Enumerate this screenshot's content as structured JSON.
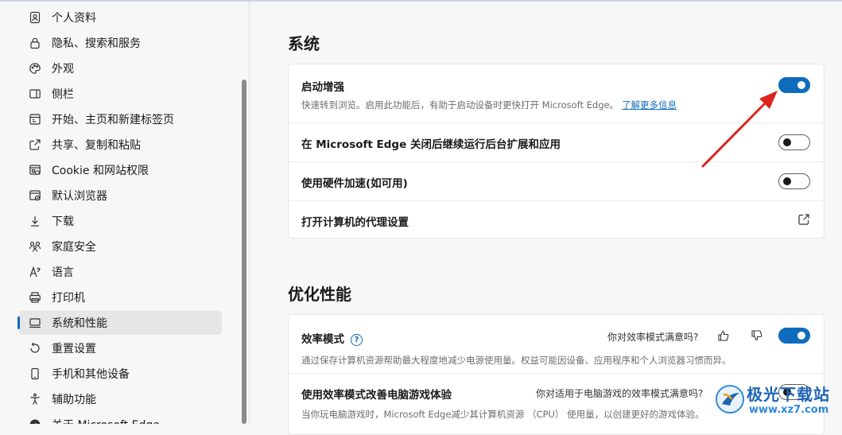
{
  "sidebar": {
    "items": [
      {
        "label": "个人资料",
        "icon": "profile-icon"
      },
      {
        "label": "隐私、搜索和服务",
        "icon": "lock-icon"
      },
      {
        "label": "外观",
        "icon": "palette-icon"
      },
      {
        "label": "侧栏",
        "icon": "sidebar-icon"
      },
      {
        "label": "开始、主页和新建标签页",
        "icon": "home-page-icon"
      },
      {
        "label": "共享、复制和粘贴",
        "icon": "share-icon"
      },
      {
        "label": "Cookie 和网站权限",
        "icon": "site-permissions-icon"
      },
      {
        "label": "默认浏览器",
        "icon": "default-browser-icon"
      },
      {
        "label": "下载",
        "icon": "download-icon"
      },
      {
        "label": "家庭安全",
        "icon": "family-icon"
      },
      {
        "label": "语言",
        "icon": "language-icon"
      },
      {
        "label": "打印机",
        "icon": "printer-icon"
      },
      {
        "label": "系统和性能",
        "icon": "system-icon",
        "active": true
      },
      {
        "label": "重置设置",
        "icon": "reset-icon"
      },
      {
        "label": "手机和其他设备",
        "icon": "phone-icon"
      },
      {
        "label": "辅助功能",
        "icon": "accessibility-icon"
      },
      {
        "label": "关于 Microsoft Edge",
        "icon": "edge-icon"
      }
    ]
  },
  "system": {
    "title": "系统",
    "startup_boost": {
      "title": "启动增强",
      "desc": "快速转到浏览。启用此功能后，有助于启动设备时更快打开 Microsoft Edge。",
      "link": "了解更多信息",
      "enabled": true
    },
    "background_run": {
      "title": "在 Microsoft Edge 关闭后继续运行后台扩展和应用",
      "enabled": false
    },
    "hardware_accel": {
      "title": "使用硬件加速(如可用)",
      "enabled": false
    },
    "proxy": {
      "title": "打开计算机的代理设置",
      "icon": "external-link-icon"
    }
  },
  "performance": {
    "title": "优化性能",
    "efficiency_mode": {
      "title": "效率模式",
      "feedback": "你对效率模式满意吗?",
      "desc": "通过保存计算机资源帮助最大程度地减少电源使用量。权益可能因设备、应用程序和个人浏览器习惯而异。",
      "enabled": true
    },
    "gaming": {
      "title": "使用效率模式改善电脑游戏体验",
      "feedback": "你对适用于电脑游戏的效率模式满意吗?",
      "desc": "当你玩电脑游戏时，Microsoft Edge减少其计算机资源 （CPU） 使用量，以创建更好的游戏体验。",
      "enabled": false
    }
  },
  "watermark": {
    "title": "极光下载站",
    "url": "www.xz7.com"
  },
  "colors": {
    "accent": "#0f6cbd",
    "arrow": "#d9261c"
  }
}
